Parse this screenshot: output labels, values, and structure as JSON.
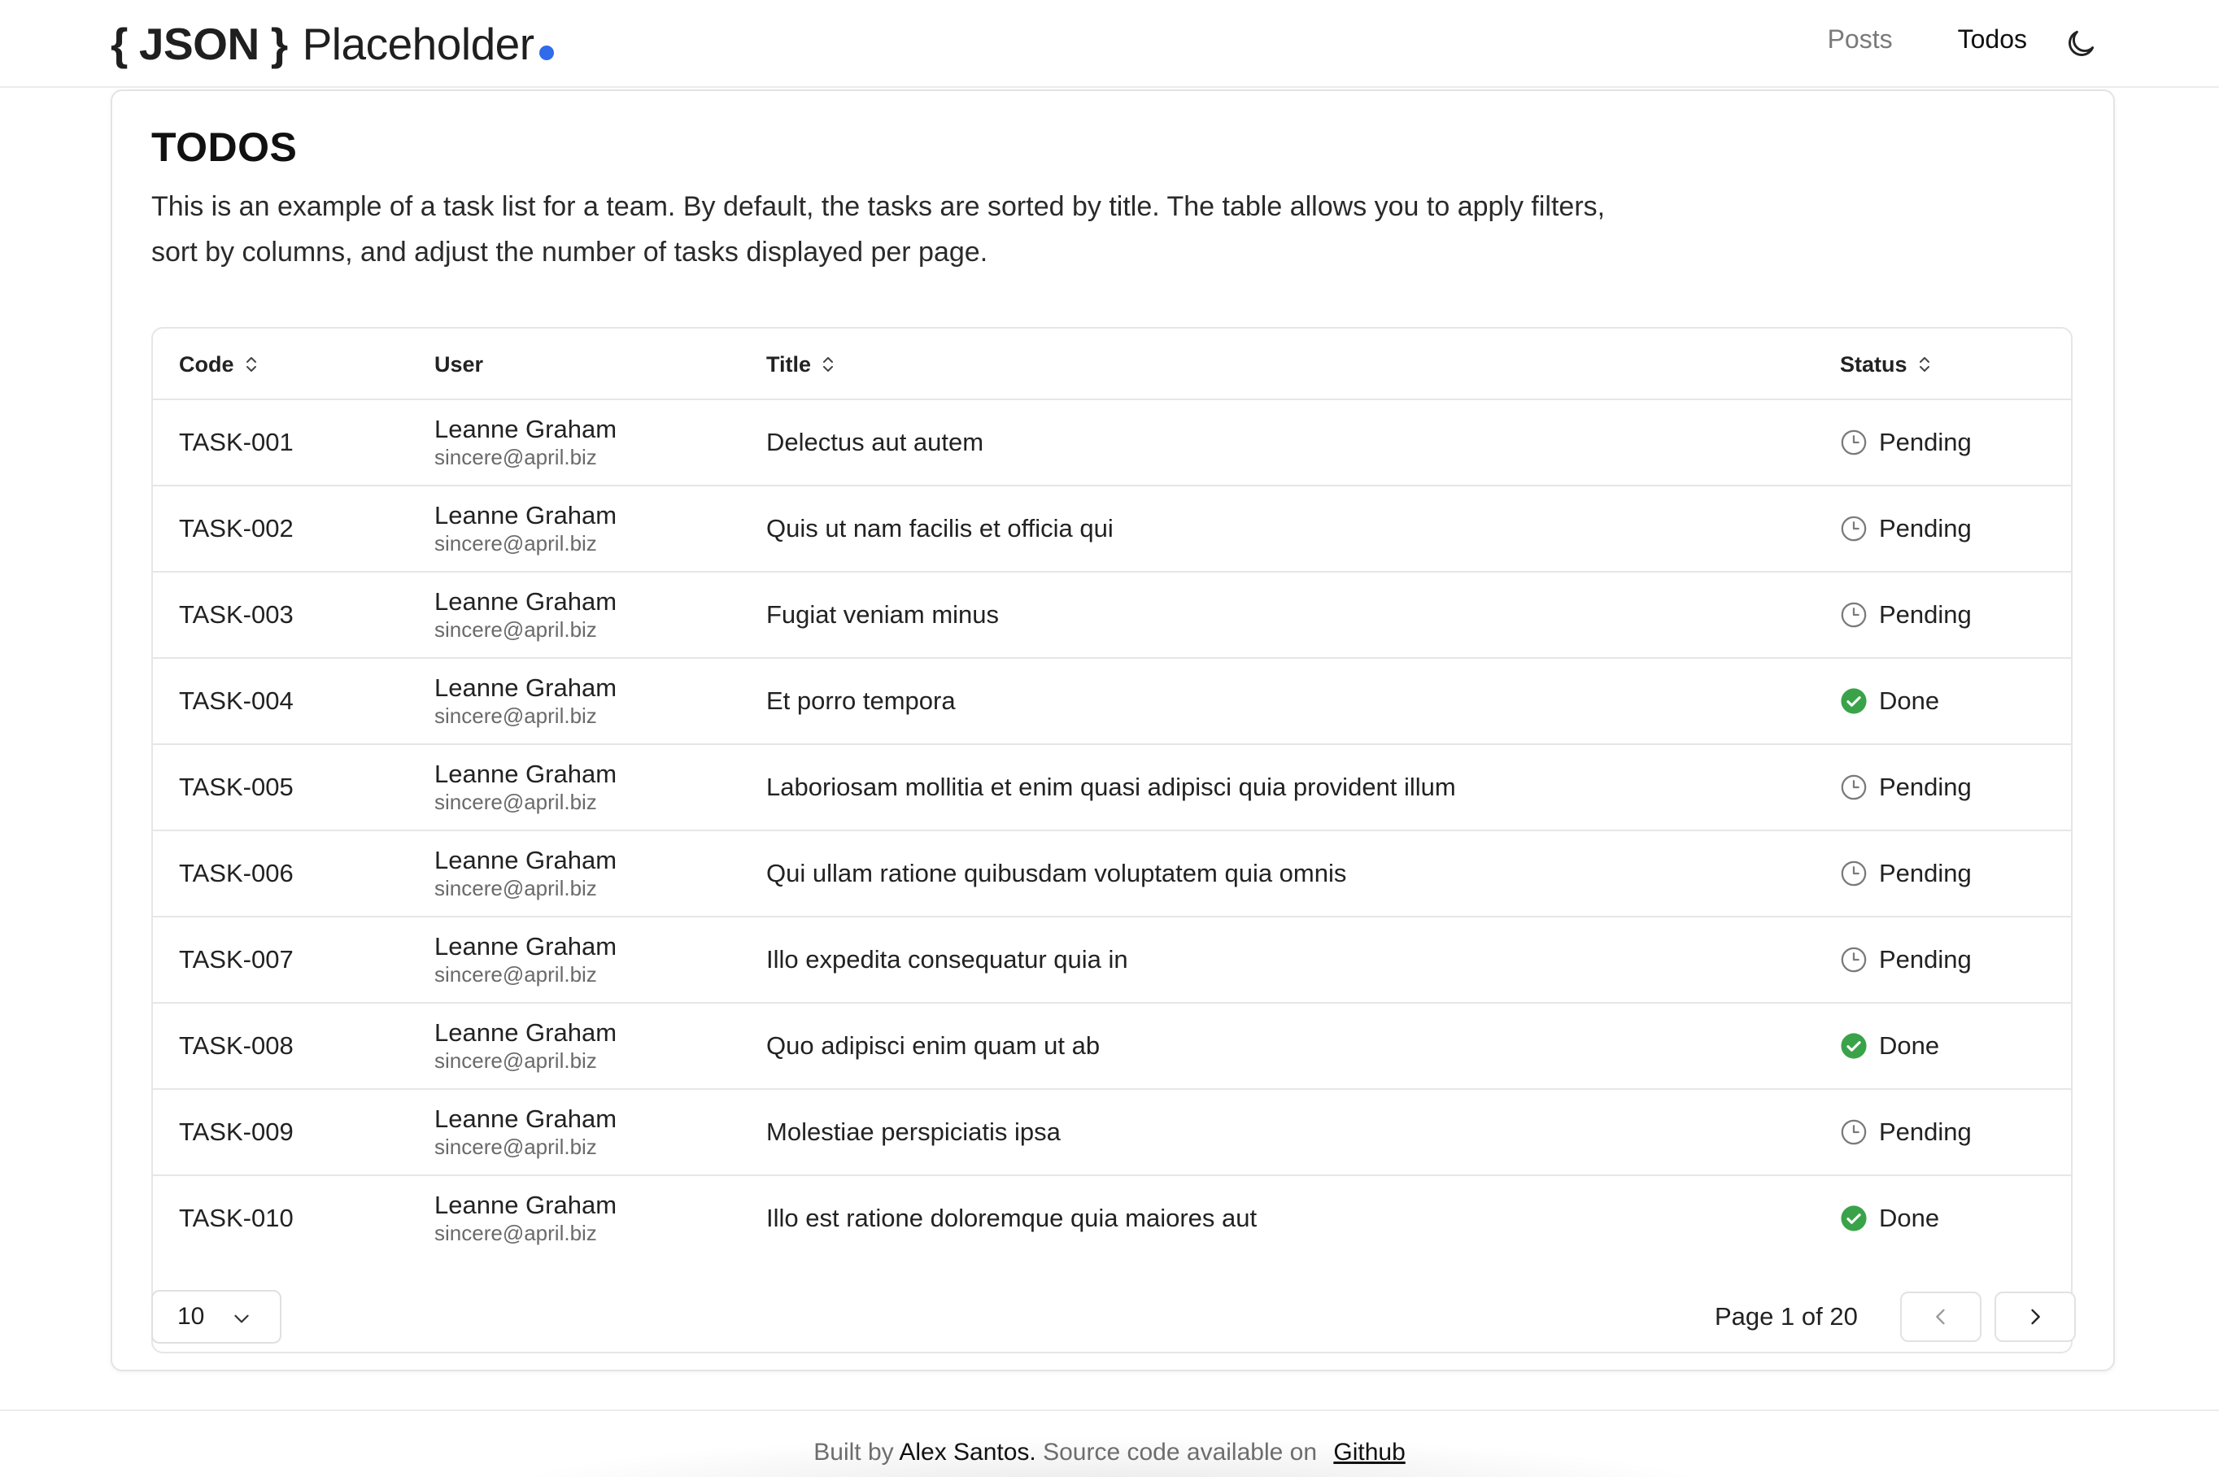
{
  "header": {
    "logo": {
      "brace_open": "{",
      "json": "JSON",
      "brace_close": "}",
      "name": "Placeholder"
    },
    "nav": [
      {
        "label": "Posts",
        "active": false
      },
      {
        "label": "Todos",
        "active": true
      }
    ],
    "theme_icon": "moon-icon"
  },
  "page": {
    "title": "TODOS",
    "description": "This is an example of a task list for a team. By default, the tasks are sorted by title. The table allows you to apply filters, sort by columns, and adjust the number of tasks displayed per page."
  },
  "table": {
    "columns": [
      "Code",
      "User",
      "Title",
      "Status"
    ],
    "sortable": [
      "Code",
      "Title",
      "Status"
    ],
    "rows": [
      {
        "code": "TASK-001",
        "user_name": "Leanne Graham",
        "user_email": "sincere@april.biz",
        "title": "Delectus aut autem",
        "status": "Pending"
      },
      {
        "code": "TASK-002",
        "user_name": "Leanne Graham",
        "user_email": "sincere@april.biz",
        "title": "Quis ut nam facilis et officia qui",
        "status": "Pending"
      },
      {
        "code": "TASK-003",
        "user_name": "Leanne Graham",
        "user_email": "sincere@april.biz",
        "title": "Fugiat veniam minus",
        "status": "Pending"
      },
      {
        "code": "TASK-004",
        "user_name": "Leanne Graham",
        "user_email": "sincere@april.biz",
        "title": "Et porro tempora",
        "status": "Done"
      },
      {
        "code": "TASK-005",
        "user_name": "Leanne Graham",
        "user_email": "sincere@april.biz",
        "title": "Laboriosam mollitia et enim quasi adipisci quia provident illum",
        "status": "Pending"
      },
      {
        "code": "TASK-006",
        "user_name": "Leanne Graham",
        "user_email": "sincere@april.biz",
        "title": "Qui ullam ratione quibusdam voluptatem quia omnis",
        "status": "Pending"
      },
      {
        "code": "TASK-007",
        "user_name": "Leanne Graham",
        "user_email": "sincere@april.biz",
        "title": "Illo expedita consequatur quia in",
        "status": "Pending"
      },
      {
        "code": "TASK-008",
        "user_name": "Leanne Graham",
        "user_email": "sincere@april.biz",
        "title": "Quo adipisci enim quam ut ab",
        "status": "Done"
      },
      {
        "code": "TASK-009",
        "user_name": "Leanne Graham",
        "user_email": "sincere@april.biz",
        "title": "Molestiae perspiciatis ipsa",
        "status": "Pending"
      },
      {
        "code": "TASK-010",
        "user_name": "Leanne Graham",
        "user_email": "sincere@april.biz",
        "title": "Illo est ratione doloremque quia maiores aut",
        "status": "Done"
      }
    ]
  },
  "pagination": {
    "page_size": "10",
    "page_info": "Page 1 of 20",
    "prev_icon": "chevron-left-icon",
    "next_icon": "chevron-right-icon"
  },
  "footer": {
    "prefix": "Built by",
    "author": "Alex Santos.",
    "middle": "Source code available on",
    "link": "Github"
  },
  "colors": {
    "accent": "#2f6bea",
    "done": "#3aa34a",
    "pending_icon": "#7a7a7a"
  }
}
